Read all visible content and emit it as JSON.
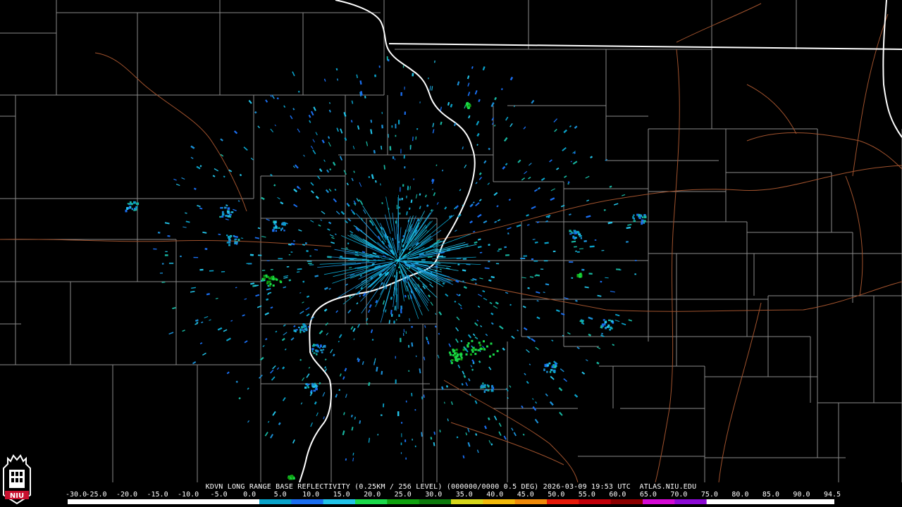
{
  "map": {
    "radar_site": "KDVN",
    "colors": {
      "background": "#000000",
      "county_lines": "#8a8a8a",
      "state_lines": "#ffffff",
      "highways": "#a0522d"
    }
  },
  "caption": "KDVN LONG RANGE BASE REFLECTIVITY (0.25KM / 256 LEVEL) (000000/0000 0.5 DEG) 2026-03-09 19:53 UTC  ATLAS.NIU.EDU",
  "scale": {
    "labels": [
      "-30.0",
      "-25.0",
      "-20.0",
      "-15.0",
      "-10.0",
      "-5.0",
      "0.0",
      "5.0",
      "10.0",
      "15.0",
      "20.0",
      "25.0",
      "30.0",
      "35.0",
      "40.0",
      "45.0",
      "50.0",
      "55.0",
      "60.0",
      "65.0",
      "70.0",
      "75.0",
      "80.0",
      "85.0",
      "90.0",
      "94.5"
    ],
    "colors": [
      "#ffffff",
      "#ffffff",
      "#ffffff",
      "#ffffff",
      "#ffffff",
      "#ffffff",
      "#0aa2c9",
      "#1a6ef0",
      "#22c3e8",
      "#1ad94a",
      "#0fa10f",
      "#0d7a0d",
      "#d6d61a",
      "#f2b90a",
      "#f08a0a",
      "#e61a0a",
      "#c2000a",
      "#8c0000",
      "#d40ad4",
      "#8c0ad4",
      "#ffffff",
      "#ffffff",
      "#ffffff",
      "#ffffff"
    ]
  },
  "logo": {
    "text": "NIU",
    "color": "#c8102e"
  }
}
